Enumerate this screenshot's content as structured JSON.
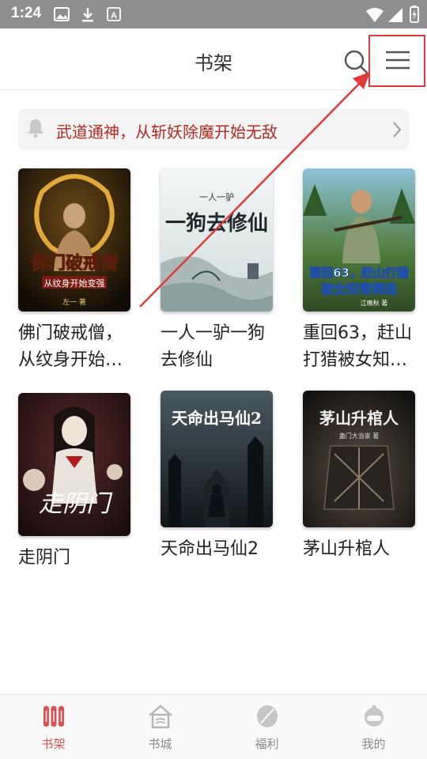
{
  "status_bar": {
    "time": "1:24"
  },
  "header": {
    "title": "书架",
    "search_icon": "search-icon",
    "menu_icon": "menu-icon"
  },
  "notice": {
    "text": "武道通神，从斩妖除魔开始无敌"
  },
  "books": [
    {
      "title": "佛门破戒僧，从纹身开始…",
      "cover_title": "佛门破戒僧",
      "cover_subtitle": "从纹身开始变强",
      "cover_author": "左一 著",
      "accent": "#d89a2a"
    },
    {
      "title": "一人一驴一狗去修仙",
      "cover_title": "一狗去修仙",
      "cover_subtitle": "一人一驴",
      "accent": "#2f3a40"
    },
    {
      "title": "重回63，赶山打猎被女知…",
      "cover_title": "重回63，赶山打猎",
      "cover_subtitle": "被女知青倒追",
      "cover_author": "江晚秋 著",
      "accent": "#1f4fa8"
    },
    {
      "title": "走阴门",
      "cover_title": "走阴门",
      "accent": "#b01a1a"
    },
    {
      "title": "天命出马仙2",
      "cover_title": "天命出马仙2",
      "accent": "#1e2b33"
    },
    {
      "title": "茅山升棺人",
      "cover_title": "茅山升棺人",
      "cover_author": "蛊门大当家 著",
      "accent": "#3a342d"
    }
  ],
  "bottom_nav": [
    {
      "label": "书架",
      "icon": "bookshelf-icon",
      "active": true
    },
    {
      "label": "书城",
      "icon": "bookstore-icon",
      "active": false
    },
    {
      "label": "福利",
      "icon": "welfare-icon",
      "active": false
    },
    {
      "label": "我的",
      "icon": "profile-icon",
      "active": false
    }
  ],
  "colors": {
    "accent": "#e05050",
    "notice_text": "#b32a1f",
    "annotation": "#e03a3a"
  }
}
